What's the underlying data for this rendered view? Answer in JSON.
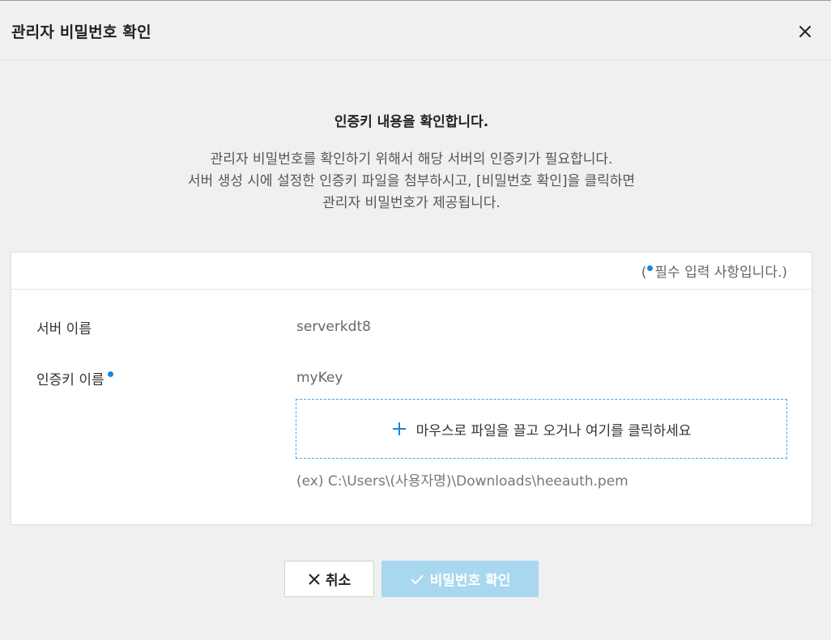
{
  "dialog": {
    "title": "관리자 비밀번호 확인"
  },
  "intro": {
    "title": "인증키 내용을 확인합니다.",
    "lines": [
      "관리자 비밀번호를 확인하기 위해서 해당 서버의 인증키가 필요합니다.",
      "서버 생성 시에 설정한 인증키 파일을 첨부하시고, [비밀번호 확인]을 클릭하면",
      "관리자 비밀번호가 제공됩니다."
    ]
  },
  "form": {
    "required_note_open": "(",
    "required_note_text": "필수 입력 사항입니다.)",
    "server_name_label": "서버 이름",
    "server_name_value": "serverkdt8",
    "key_name_label": "인증키 이름",
    "key_name_value": "myKey",
    "upload_text": "마우스로 파일을 끌고 오거나 여기를 클릭하세요",
    "example_path": "(ex) C:\\Users\\(사용자명)\\Downloads\\heeauth.pem"
  },
  "buttons": {
    "cancel_label": "취소",
    "confirm_label": "비밀번호 확인"
  },
  "colors": {
    "accent": "#1a86d6",
    "upload_border": "#4aa7e6",
    "confirm_disabled_bg": "#a9d7ef"
  },
  "icons": {
    "close": "close-icon",
    "plus": "plus-icon",
    "cancel": "x-icon",
    "confirm": "check-icon",
    "required": "required-dot-icon"
  }
}
